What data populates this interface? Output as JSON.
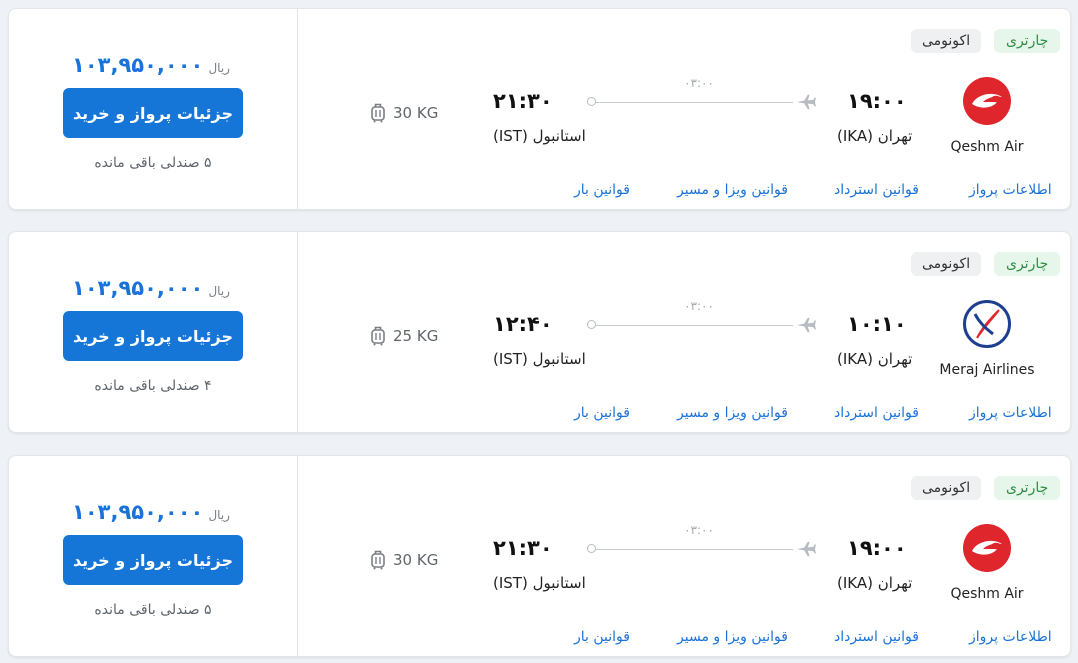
{
  "flights": [
    {
      "airline": "Qeshm Air",
      "logo": "qeshm-air-logo",
      "badge_charter": "چارتری",
      "badge_class": "اکونومی",
      "dep_time": "۱۹:۰۰",
      "dep_city": "تهران (IKA)",
      "arr_time": "۲۱:۳۰",
      "arr_city": "استانبول (IST)",
      "duration": "۰۳:۰۰",
      "baggage": "30 KG",
      "price": "۱۰۳,۹۵۰,۰۰۰",
      "currency": "ریال",
      "button": "جزئیات پرواز و خرید",
      "seats": "۵ صندلی باقی مانده",
      "links": {
        "info": "اطلاعات پرواز",
        "refund": "قوانین استرداد",
        "visa": "قوانین ویزا و مسیر",
        "bag": "قوانین بار"
      }
    },
    {
      "airline": "Meraj Airlines",
      "logo": "meraj-airlines-logo",
      "badge_charter": "چارتری",
      "badge_class": "اکونومی",
      "dep_time": "۱۰:۱۰",
      "dep_city": "تهران (IKA)",
      "arr_time": "۱۲:۴۰",
      "arr_city": "استانبول (IST)",
      "duration": "۰۳:۰۰",
      "baggage": "25 KG",
      "price": "۱۰۳,۹۵۰,۰۰۰",
      "currency": "ریال",
      "button": "جزئیات پرواز و خرید",
      "seats": "۴ صندلی باقی مانده",
      "links": {
        "info": "اطلاعات پرواز",
        "refund": "قوانین استرداد",
        "visa": "قوانین ویزا و مسیر",
        "bag": "قوانین بار"
      }
    },
    {
      "airline": "Qeshm Air",
      "logo": "qeshm-air-logo",
      "badge_charter": "چارتری",
      "badge_class": "اکونومی",
      "dep_time": "۱۹:۰۰",
      "dep_city": "تهران (IKA)",
      "arr_time": "۲۱:۳۰",
      "arr_city": "استانبول (IST)",
      "duration": "۰۳:۰۰",
      "baggage": "30 KG",
      "price": "۱۰۳,۹۵۰,۰۰۰",
      "currency": "ریال",
      "button": "جزئیات پرواز و خرید",
      "seats": "۵ صندلی باقی مانده",
      "links": {
        "info": "اطلاعات پرواز",
        "refund": "قوانین استرداد",
        "visa": "قوانین ویزا و مسیر",
        "bag": "قوانین بار"
      }
    }
  ],
  "colors": {
    "accent": "#1576d8",
    "price": "#1a73d9",
    "charter_bg": "#e7f6ea",
    "charter_text": "#2f8d45",
    "qeshm_red": "#e0262d",
    "meraj_blue": "#1d3f8f"
  }
}
